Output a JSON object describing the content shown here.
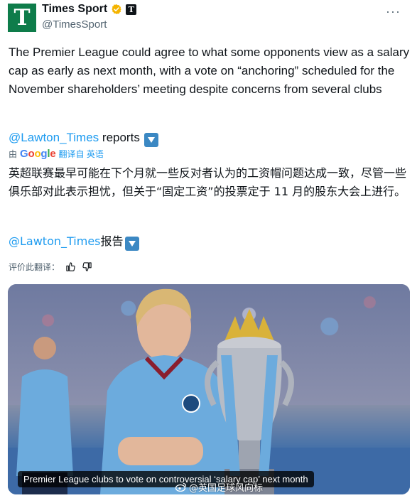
{
  "author": {
    "display_name": "Times Sport",
    "handle": "@TimesSport",
    "avatar_letter": "T",
    "affiliate_letter": "T",
    "verified_color": "#f4b400",
    "avatar_color": "#0e7c4a"
  },
  "more_label": "···",
  "tweet": {
    "text": "The Premier League could agree to what some opponents view as a salary cap as early as next month, with a vote on “anchoring” scheduled for the November shareholders’ meeting despite concerns from several clubs",
    "mention": "@Lawton_Times",
    "reports_word": " reports"
  },
  "translation": {
    "by_label": "由",
    "google": [
      "G",
      "o",
      "o",
      "g",
      "l",
      "e"
    ],
    "link_label": "翻译自 英语",
    "text": "英超联赛最早可能在下个月就一些反对者认为的工资帽问题达成一致，尽管一些俱乐部对此表示担忧，但关于“固定工资”的投票定于 11 月的股东大会上进行。",
    "mention": "@Lawton_Times",
    "reports_word": "报告",
    "rate_label": "评价此翻译："
  },
  "media": {
    "caption": "Premier League clubs to vote on controversial ‘salary cap’ next month",
    "watermark": "@英国足球风向标"
  },
  "colors": {
    "link": "#1d9bf0",
    "badge_blue": "#3b88c3",
    "city_sky_blue": "#6cabdd"
  }
}
